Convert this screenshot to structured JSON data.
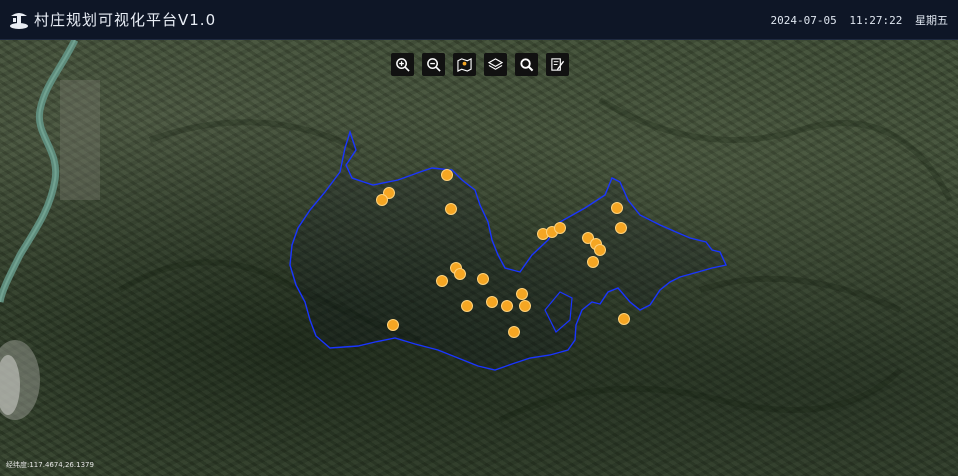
{
  "header": {
    "title": "村庄规划可视化平台V1.0",
    "date": "2024-07-05",
    "time": "11:27:22",
    "weekday": "星期五"
  },
  "toolbar": {
    "tools": [
      {
        "name": "zoom-in-tool",
        "icon": "zoom-in-icon"
      },
      {
        "name": "zoom-out-tool",
        "icon": "zoom-out-icon"
      },
      {
        "name": "map-tool",
        "icon": "map-icon"
      },
      {
        "name": "layers-tool",
        "icon": "layers-icon"
      },
      {
        "name": "search-tool",
        "icon": "search-icon"
      },
      {
        "name": "edit-tool",
        "icon": "edit-icon"
      }
    ]
  },
  "map": {
    "coord_readout": "经纬度:117.4674,26.1379",
    "poi_color": "#f5a623",
    "boundary_color": "#1a35ff"
  }
}
